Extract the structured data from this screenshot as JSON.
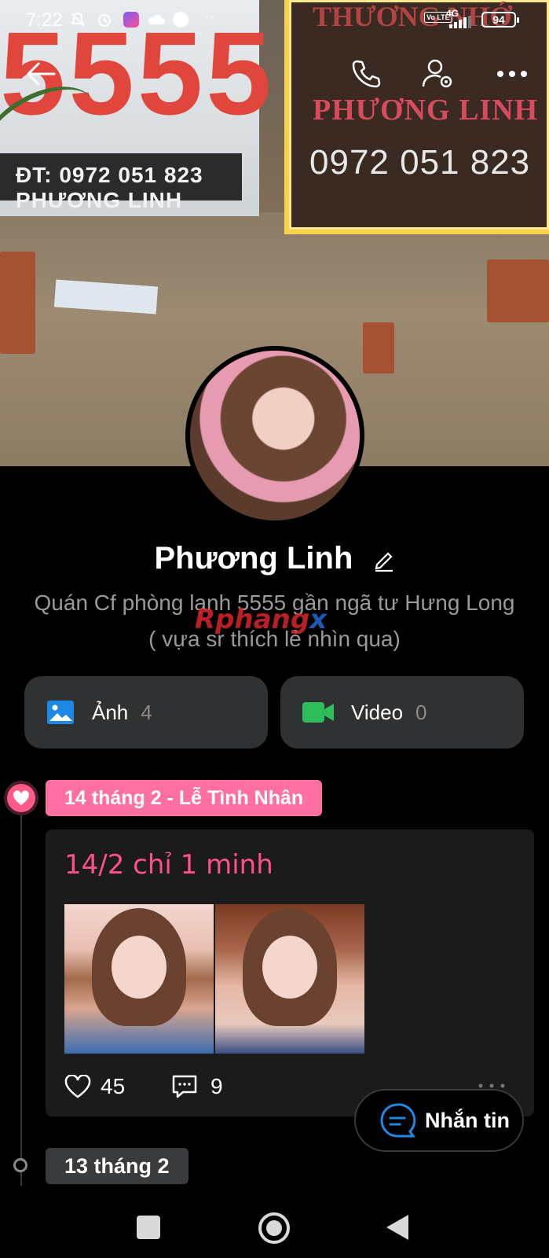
{
  "status_bar": {
    "time": "7:22",
    "network": "4G",
    "volte": "Vo LTE",
    "battery": "94"
  },
  "cover": {
    "sign_left_number": "5555",
    "sign_left_strip": "ĐT: 0972 051 823 PHƯƠNG LINH",
    "sign_right_brand": "THƯƠNG NHỚ",
    "sign_right_name": "PHƯƠNG LINH",
    "sign_right_phone": "0972 051 823"
  },
  "profile": {
    "name": "Phương Linh",
    "bio": "Quán Cf phòng lạnh 5555 gần ngã tư Hưng Long ( vựa sr thích lẻ nhìn qua)"
  },
  "watermark": {
    "red": "Rphang",
    "blue": "x"
  },
  "media_tiles": [
    {
      "label": "Ảnh",
      "count": "4"
    },
    {
      "label": "Video",
      "count": "0"
    }
  ],
  "timeline": {
    "event_tag": "14 tháng 2 - Lễ Tình Nhân",
    "post": {
      "title": "14/2 chỉ 1 minh",
      "likes": "45",
      "comments": "9"
    },
    "next_date_tag": "13 tháng 2"
  },
  "message_button": {
    "label": "Nhắn tin"
  },
  "colors": {
    "accent_pink": "#ff6fa2",
    "accent_blue": "#1e88e5",
    "video_green": "#2dbd5a",
    "tile_bg": "#2f3133"
  }
}
